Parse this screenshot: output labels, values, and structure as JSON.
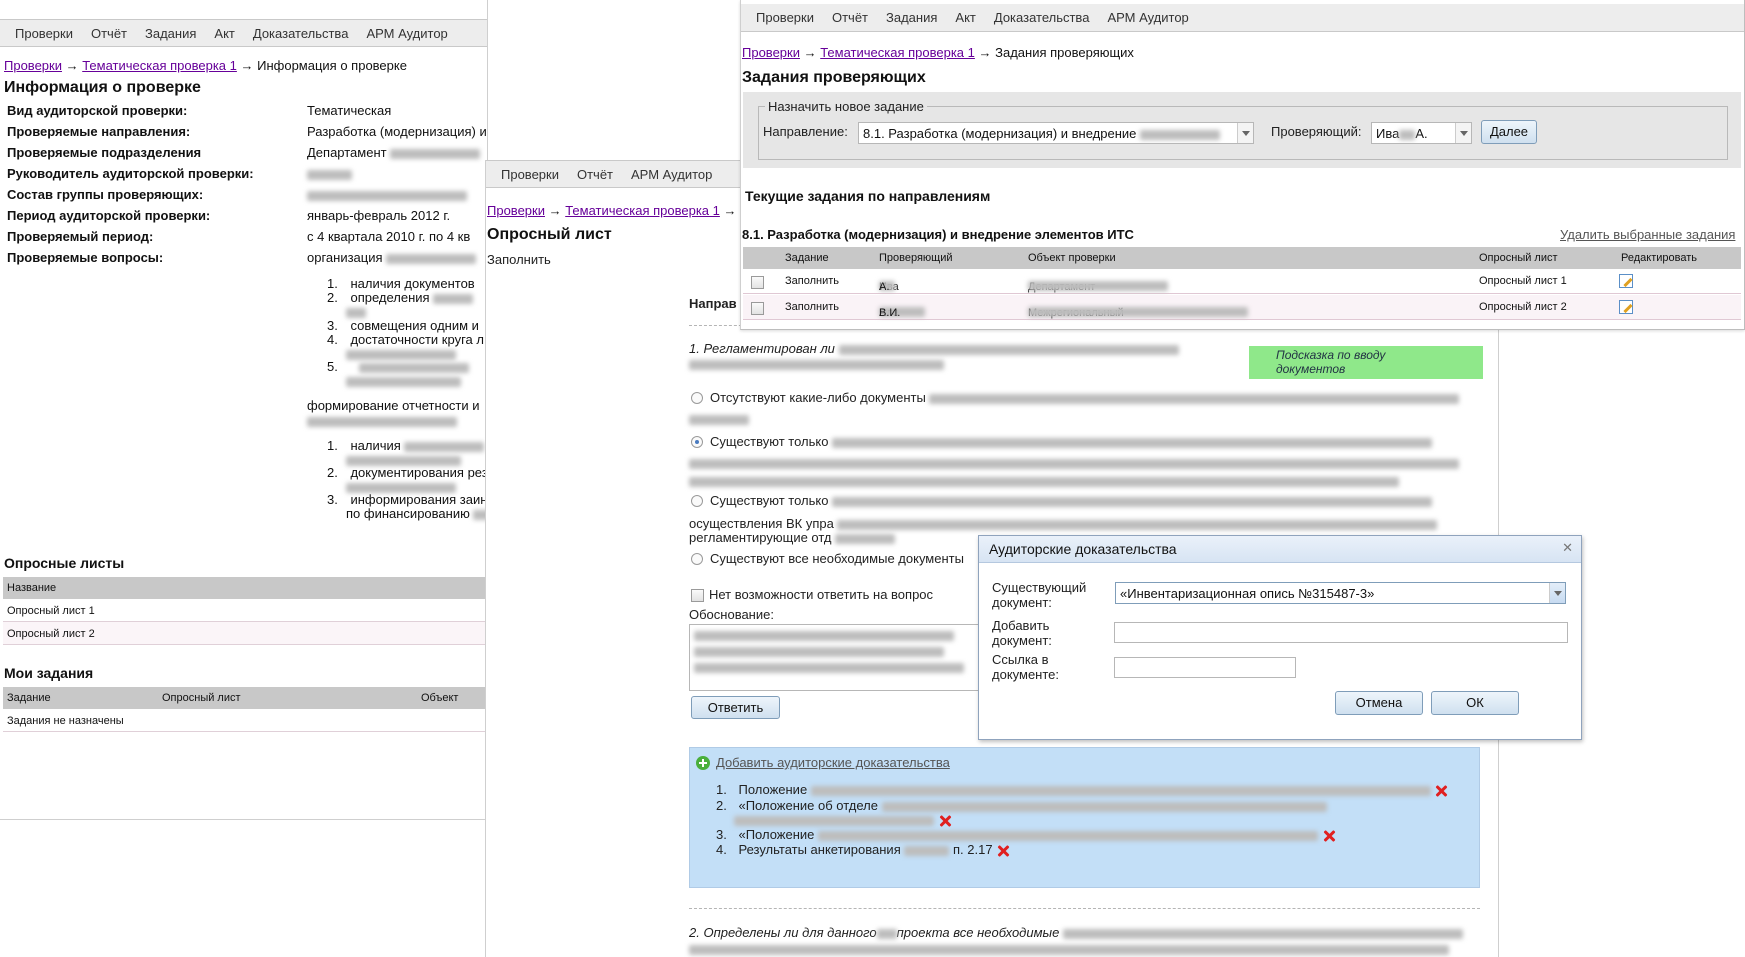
{
  "menu_full": [
    "Проверки",
    "Отчёт",
    "Задания",
    "Акт",
    "Доказательства",
    "АРМ Аудитор"
  ],
  "menu_short": [
    "Проверки",
    "Отчёт",
    "АРМ Аудитор"
  ],
  "info_window": {
    "crumb_root": "Проверки",
    "crumb_mid": "Тематическая проверка 1",
    "crumb_current": "Информация о проверке",
    "title": "Информация о проверке",
    "rows": [
      {
        "label": "Вид аудиторской проверки:",
        "value": "Тематическая"
      },
      {
        "label": "Проверяемые направления:",
        "value": "Разработка (модернизация) и внедрение"
      },
      {
        "label": "Проверяемые подразделения",
        "value": "Департамент"
      },
      {
        "label": "Руководитель аудиторской проверки:",
        "value": ""
      },
      {
        "label": "Состав группы проверяющих:",
        "value": ""
      },
      {
        "label": "Период аудиторской проверки:",
        "value": "январь-февраль 2012 г."
      },
      {
        "label": "Проверяемый период:",
        "value": "с 4 квартала 2010 г. по 4 кв"
      },
      {
        "label": "Проверяемые вопросы:",
        "value": "организация"
      }
    ],
    "list1": [
      "наличия документов",
      "определения",
      "совмещения одним и",
      "достаточности круга л",
      ""
    ],
    "reporting": "формирование отчетности и",
    "list2": [
      "наличия",
      "документирования рез",
      "информирования заин",
      "по финансированию"
    ],
    "questionnaires_title": "Опросные листы",
    "q_col": "Название",
    "questionnaires": [
      "Опросный лист 1",
      "Опросный лист 2"
    ],
    "tasks_title": "Мои задания",
    "task_cols": [
      "Задание",
      "Опросный лист",
      "Объект"
    ],
    "no_tasks": "Задания не назначены"
  },
  "quest_window": {
    "crumb_root": "Проверки",
    "crumb_mid": "Тематическая проверка 1",
    "title": "Опросный лист",
    "subtitle": "Заполнить",
    "direction": "Направ",
    "q1": "1. Регламентирован ли",
    "hint": "Подсказка по вводу документов",
    "options": [
      "Отсутствуют какие-либо документы",
      "Существуют только",
      "Существуют только",
      "Существуют все необходимые документы"
    ],
    "opt3_line2": "осуществления ВК упра",
    "opt3_line3": "регламентирующие отд",
    "no_answer": "Нет возможности ответить на вопрос",
    "justification": "Обоснование:",
    "answer_btn": "Ответить",
    "add_evidence": "Добавить аудиторские доказательства",
    "evidence": [
      "Положение",
      "«Положение об отделе",
      "«Положение",
      "Результаты анкетирования"
    ],
    "evidence4_tail": "п. 2.17",
    "q2": "2. Определены ли для данного",
    "q2_tail": "проекта все необходимые"
  },
  "tasks_window": {
    "crumb_root": "Проверки",
    "crumb_mid": "Тематическая проверка 1",
    "crumb_current": "Задания проверяющих",
    "title": "Задания проверяющих",
    "fieldset_legend": "Назначить новое задание",
    "direction_label": "Направление:",
    "direction_value": "8.1. Разработка (модернизация) и внедрение",
    "inspector_label": "Проверяющий:",
    "inspector_value": "Ива",
    "inspector_tail": "А.",
    "next_btn": "Далее",
    "current_title": "Текущие задания по направлениям",
    "section": "8.1. Разработка (модернизация) и внедрение элементов ИТС",
    "delete_link": "Удалить выбранные задания",
    "columns": [
      "Задание",
      "Проверяющий",
      "Объект проверки",
      "Опросный лист",
      "Редактировать"
    ],
    "rows": [
      {
        "task": "Заполнить",
        "inspector": "Ива",
        "inspector_tail": "А.",
        "object": "Департамент",
        "questionnaire": "Опросный лист 1"
      },
      {
        "task": "Заполнить",
        "inspector": "Але",
        "inspector_tail": "В.И.",
        "object": "Межрегиональный",
        "questionnaire": "Опросный лист 2"
      }
    ]
  },
  "dialog": {
    "title": "Аудиторские доказательства",
    "existing_label": "Существующий документ:",
    "existing_value": "«Инвентаризационная опись №315487-3»",
    "add_label": "Добавить документ:",
    "link_label": "Ссылка в документе:",
    "cancel": "Отмена",
    "ok": "ОК"
  }
}
